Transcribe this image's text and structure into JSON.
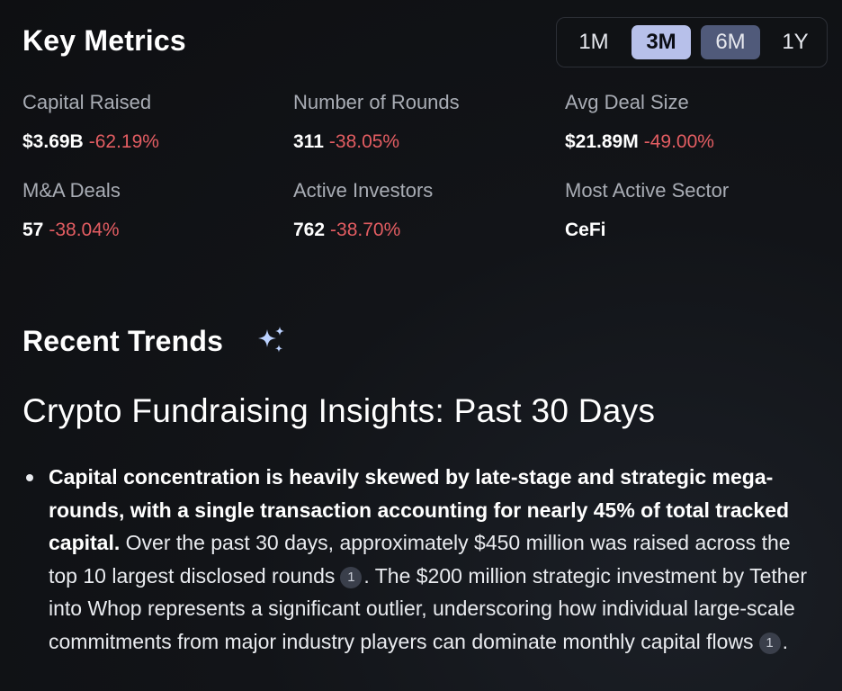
{
  "key_metrics": {
    "title": "Key Metrics",
    "ranges": [
      {
        "label": "1M",
        "state": "default"
      },
      {
        "label": "3M",
        "state": "selected"
      },
      {
        "label": "6M",
        "state": "hover"
      },
      {
        "label": "1Y",
        "state": "default"
      }
    ],
    "metrics": [
      {
        "label": "Capital Raised",
        "value": "$3.69B",
        "change": "-62.19%"
      },
      {
        "label": "Number of Rounds",
        "value": "311",
        "change": "-38.05%"
      },
      {
        "label": "Avg Deal Size",
        "value": "$21.89M",
        "change": "-49.00%"
      },
      {
        "label": "M&A Deals",
        "value": "57",
        "change": "-38.04%"
      },
      {
        "label": "Active Investors",
        "value": "762",
        "change": "-38.70%"
      },
      {
        "label": "Most Active Sector",
        "value": "CeFi",
        "change": ""
      }
    ]
  },
  "recent_trends": {
    "title": "Recent Trends",
    "sparkle_icon": "sparkle-icon",
    "heading": "Crypto Fundraising Insights: Past 30 Days",
    "bullets": [
      {
        "bold": "Capital concentration is heavily skewed by late-stage and strategic mega-rounds, with a single transaction accounting for nearly 45% of total tracked capital.",
        "text1": " Over the past 30 days, approximately $450 million was raised across the top 10 largest disclosed rounds",
        "cite1": "1",
        "text2": ". The $200 million strategic investment by Tether into Whop represents a significant outlier, underscoring how individual large-scale commitments from major industry players can dominate monthly capital flows",
        "cite2": "1",
        "text3": "."
      }
    ]
  },
  "colors": {
    "background": "#121418",
    "negative_change": "#e35d62",
    "selected_range": "#b7c0ea",
    "hover_range": "#505a7a",
    "muted_label": "#a9adb5",
    "sparkle": "#bcd2ff"
  }
}
